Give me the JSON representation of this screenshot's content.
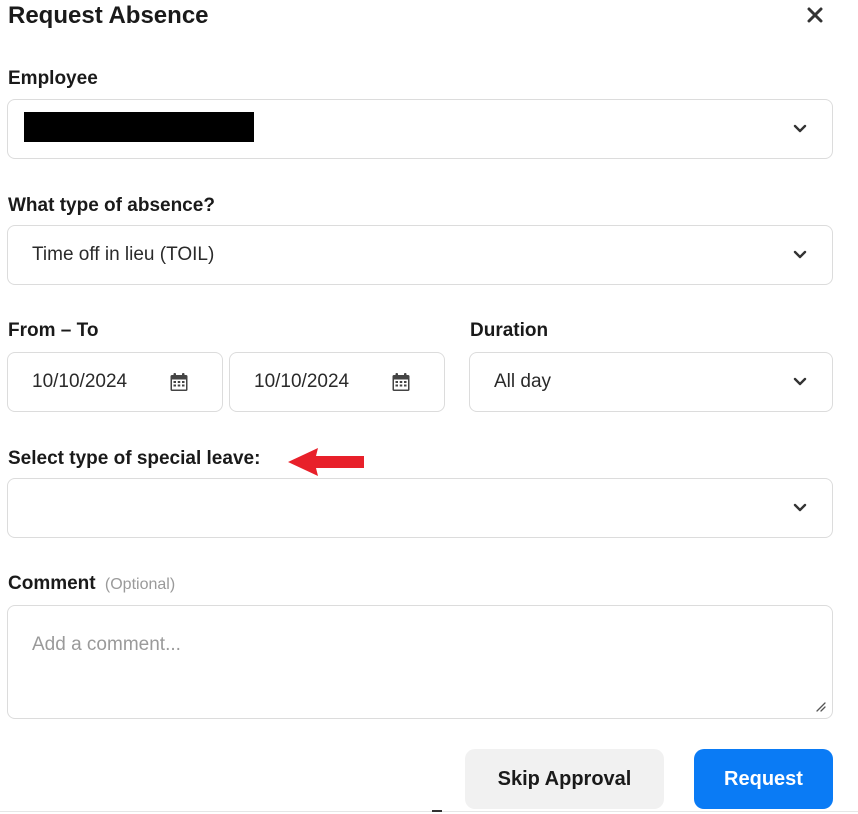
{
  "dialog": {
    "title": "Request Absence"
  },
  "employee": {
    "label": "Employee"
  },
  "absence_type": {
    "label": "What type of absence?",
    "value": "Time off in lieu (TOIL)"
  },
  "dates": {
    "label": "From – To",
    "from": "10/10/2024",
    "to": "10/10/2024"
  },
  "duration": {
    "label": "Duration",
    "value": "All day"
  },
  "special_leave": {
    "label": "Select type of special leave:",
    "value": ""
  },
  "comment": {
    "label": "Comment",
    "optional": "(Optional)",
    "placeholder": "Add a comment..."
  },
  "actions": {
    "skip_label": "Skip Approval",
    "request_label": "Request"
  },
  "colors": {
    "primary": "#0a7bf5",
    "arrow": "#e8202a",
    "border": "#dcdcdc"
  },
  "icons": {
    "close": "close-icon",
    "chevron": "chevron-down-icon",
    "calendar": "calendar-icon",
    "annotation": "red-arrow-icon"
  }
}
